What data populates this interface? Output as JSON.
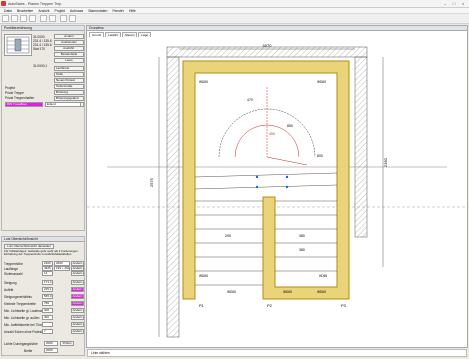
{
  "window": {
    "title": "AutoStairs - Planen Treppen Trep"
  },
  "menu": [
    "Datei",
    "Bearbeiten",
    "Ansicht",
    "Projekt",
    "Aufmass",
    "Stammdaten",
    "Fenster",
    "Hilfe"
  ],
  "top_panel": {
    "title": "Punktbezeichnung",
    "coords": [
      "31.0000",
      "231.4 / 135.6",
      "231.4 / 135.6",
      "Stat 170",
      "31.0000,1"
    ],
    "side_buttons": [
      "Ändern",
      "Ausblenden",
      "Ausführl.",
      "Bestandteile",
      "Leere"
    ],
    "menu_items": [
      "Laufbreite",
      "Stufe",
      "Neues Podest",
      "Stufenmaße",
      "Brüstung",
      "Brüstungsgeländ",
      "Verzierhandlung"
    ],
    "project_labels": [
      "Projekt",
      "Privat Treppe",
      "Privat Treppenhallen"
    ],
    "highlight_label": "DIN 7-Laufbau",
    "select_value": "Erland"
  },
  "bottom_panel": {
    "title": "Lotz Übersicht/Ansicht",
    "top_button": "Lotz Übersicht/Ansicht darstellen",
    "note": "Für Vollständiges: Gebäude geht mehr als 2 Forderungen. Einhaltung der Treppenlimits zu Auftrittshaltetabellen",
    "rows": [
      {
        "label": "Treppenhöhe",
        "v1": "2400",
        "v2": "2600",
        "btn": "Ändern"
      },
      {
        "label": "Lauflänge",
        "v1": "4625",
        "v2": "199 + 4625",
        "btn": "Ändern"
      },
      {
        "label": "Stufenanzahl",
        "v1": "14",
        "v2": "",
        "btn": "Ändern"
      },
      {
        "label": "Steigung",
        "v1": "171.4",
        "v2": "",
        "btn": "Ändern"
      },
      {
        "label": "Auftritt",
        "v1": "225.1",
        "v2": "",
        "btn": "Ändern"
      },
      {
        "label": "Steigungsverhältnis",
        "v1": "565.0",
        "v2": "",
        "btn": "Ändern"
      },
      {
        "label": "Kleinste Treppenbreite",
        "v1": "780",
        "v2": "",
        "btn": "Ändern"
      },
      {
        "label": "Min. Lichtweite gl. Laufmax",
        "v1": "400",
        "v2": "",
        "btn": "Ändern"
      },
      {
        "label": "Min. Lichtweite gr. außen",
        "v1": "400",
        "v2": "",
        "btn": "Ändern"
      },
      {
        "label": "Min. Auftrittsbreite bei 70cm",
        "v1": "",
        "v2": "",
        "btn": "Ändern"
      },
      {
        "label": "Anzahl Ecken ohne Podest",
        "v1": "7",
        "v2": "",
        "btn": "Ändern"
      }
    ],
    "footer": {
      "label": "Lichte Durchgangshöhe",
      "value": "2000",
      "button": "Prüfen",
      "label2": "Breite",
      "value2": "2000"
    }
  },
  "drawing": {
    "title": "Grundriss",
    "tabs": [
      "Grundr",
      "Lauflini",
      "Stenen",
      "Lage"
    ],
    "dimensions": {
      "top": "5070",
      "top_inner": "1000",
      "left": "2575",
      "right": "2350",
      "bottom_left": "290",
      "bottom_mid": "380",
      "bottom_right": "380",
      "vertical": "800",
      "mid": "850",
      "upper": "470",
      "small": "400"
    },
    "labels": [
      "WD65",
      "WD65",
      "WD65",
      "HD65",
      "P1",
      "P2",
      "P3",
      "WD65",
      "WD65",
      "WD65"
    ]
  },
  "command_line": {
    "placeholder": "Linie wählen"
  },
  "colors": {
    "stringer": "#b58a10",
    "stringer_fill": "#ead47a",
    "highlight": "#e020e0",
    "red": "#d22020",
    "blue": "#2060e0"
  }
}
